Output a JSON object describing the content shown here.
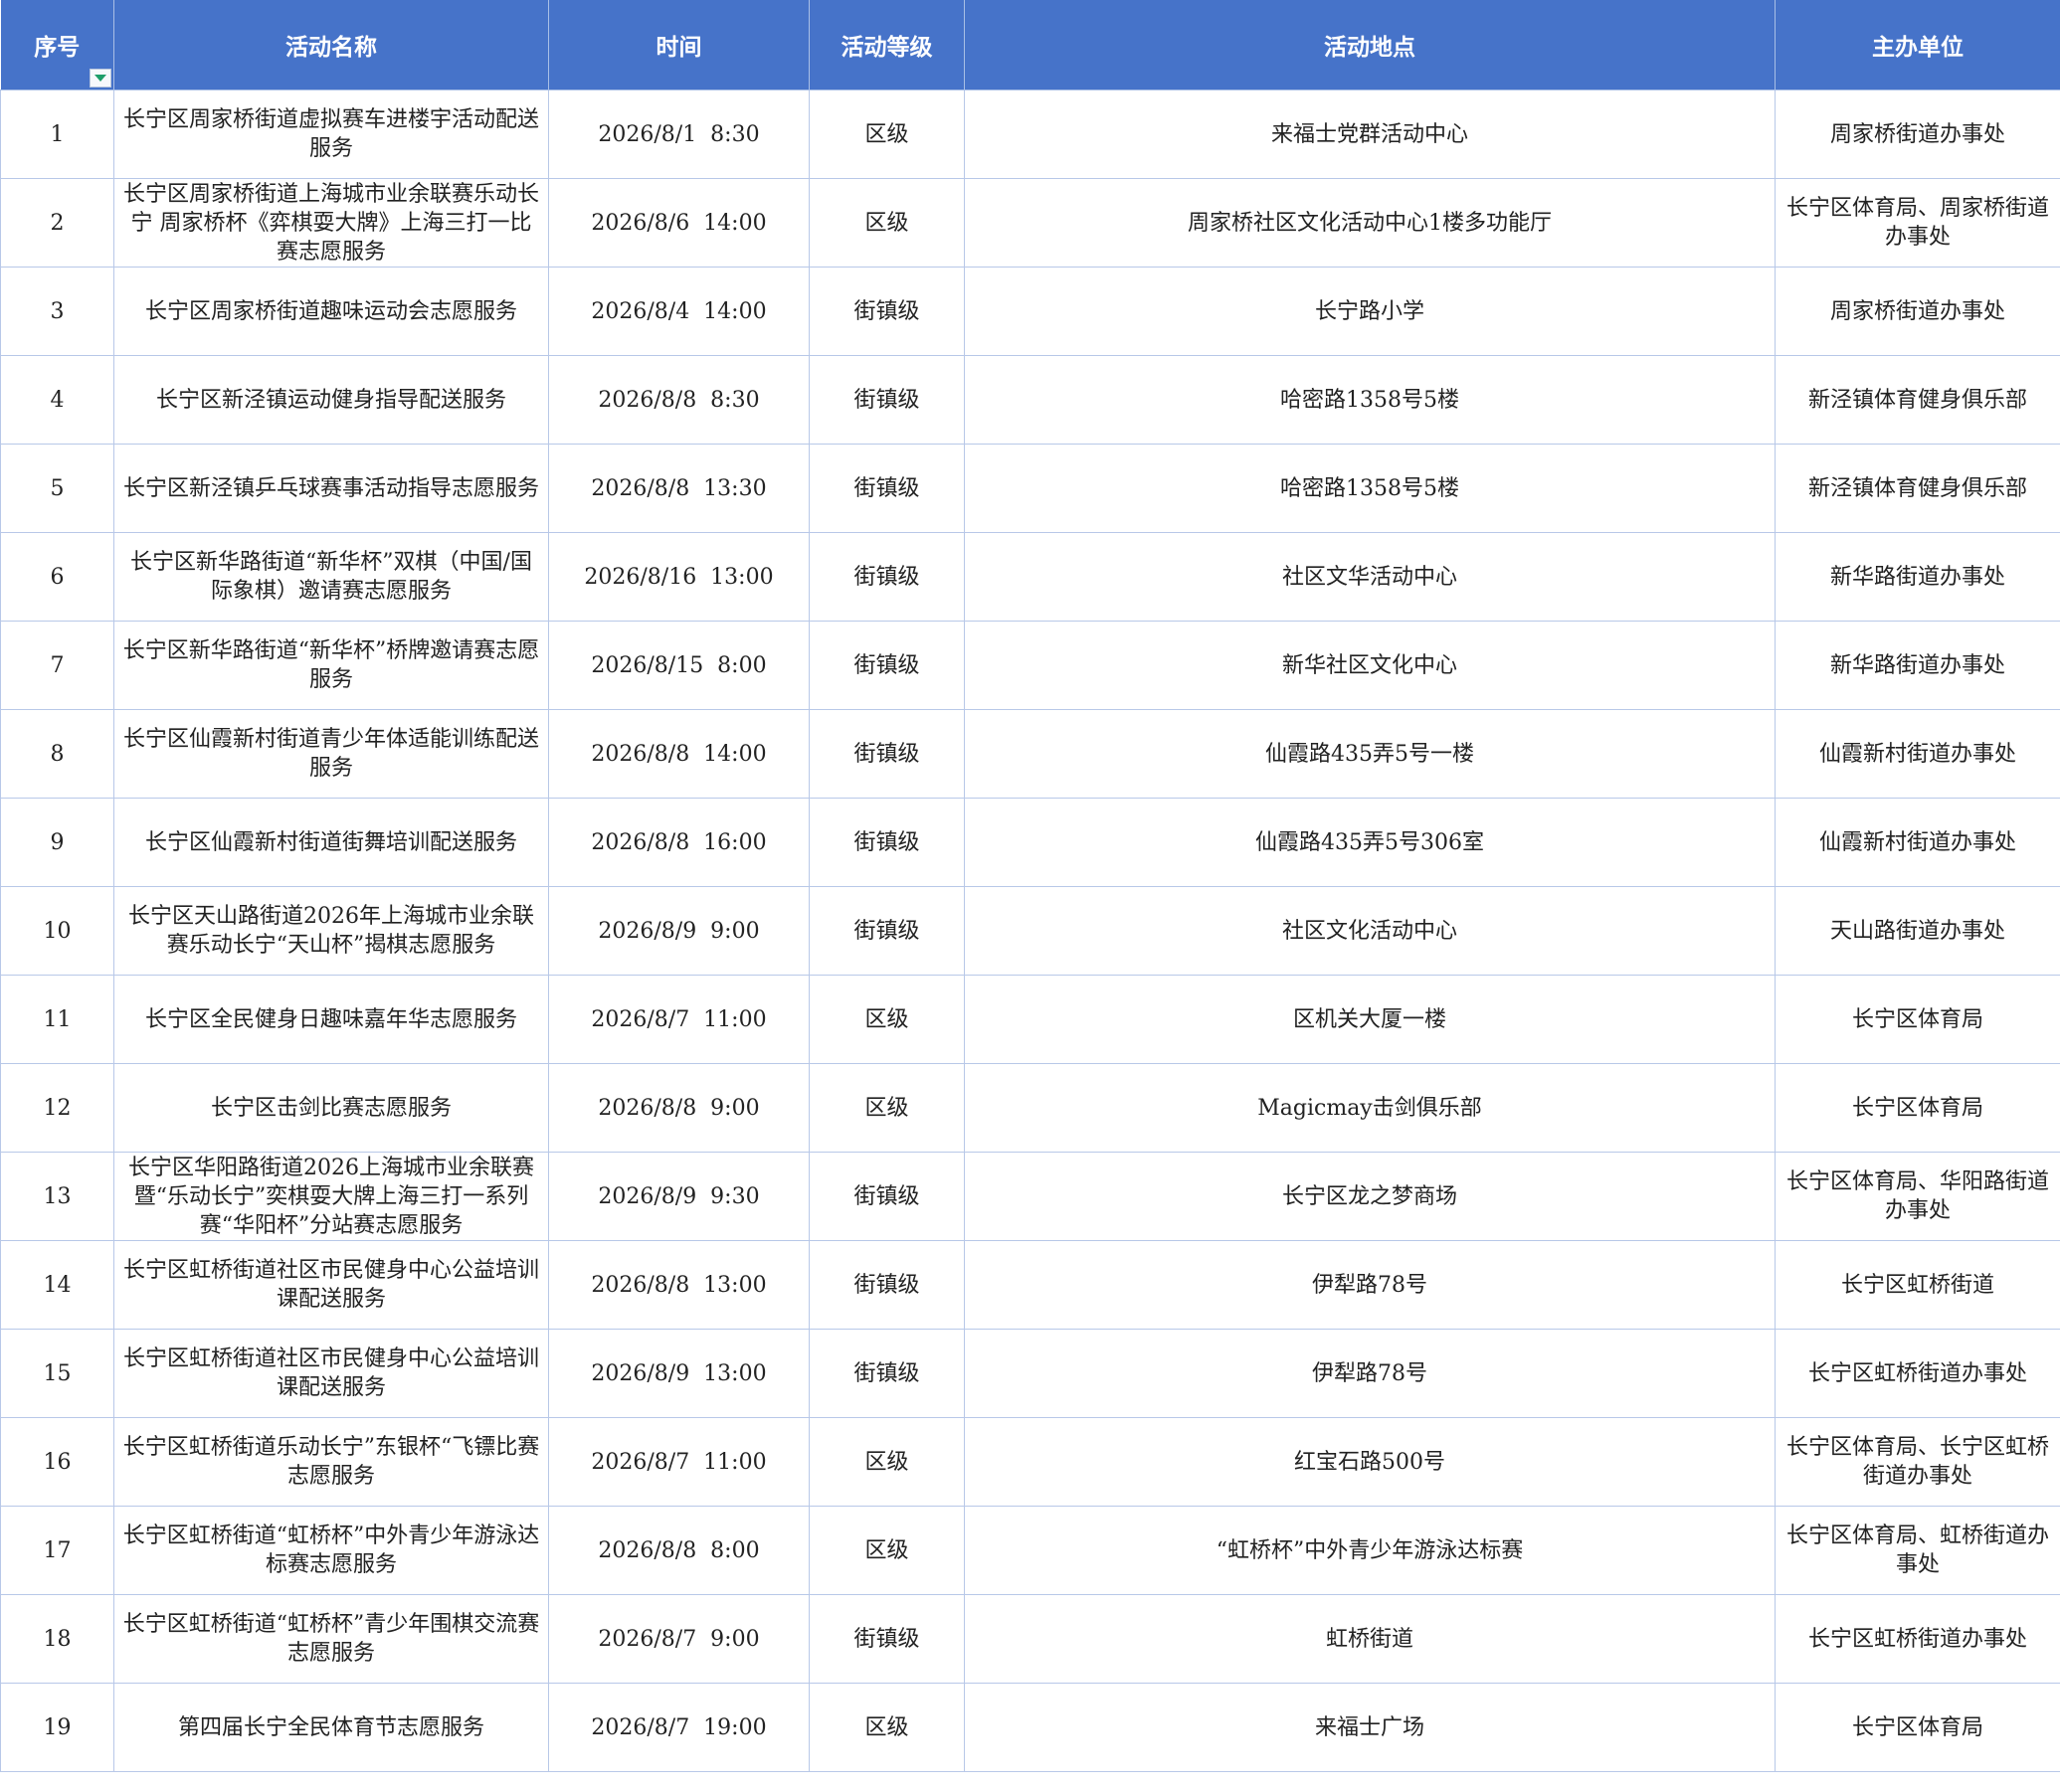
{
  "headers": [
    "序号",
    "活动名称",
    "时间",
    "活动等级",
    "活动地点",
    "主办单位"
  ],
  "rows": [
    [
      "1",
      "长宁区周家桥街道虚拟赛车进楼宇活动配送服务",
      "2026/8/1  8:30",
      "区级",
      "来福士党群活动中心",
      "周家桥街道办事处"
    ],
    [
      "2",
      "长宁区周家桥街道上海城市业余联赛乐动长宁 周家桥杯《弈棋耍大牌》上海三打一比赛志愿服务",
      "2026/8/6  14:00",
      "区级",
      "周家桥社区文化活动中心1楼多功能厅",
      "长宁区体育局、周家桥街道办事处"
    ],
    [
      "3",
      "长宁区周家桥街道趣味运动会志愿服务",
      "2026/8/4  14:00",
      "街镇级",
      "长宁路小学",
      "周家桥街道办事处"
    ],
    [
      "4",
      "长宁区新泾镇运动健身指导配送服务",
      "2026/8/8  8:30",
      "街镇级",
      "哈密路1358号5楼",
      "新泾镇体育健身俱乐部"
    ],
    [
      "5",
      "长宁区新泾镇乒乓球赛事活动指导志愿服务",
      "2026/8/8  13:30",
      "街镇级",
      "哈密路1358号5楼",
      "新泾镇体育健身俱乐部"
    ],
    [
      "6",
      "长宁区新华路街道“新华杯”双棋（中国/国际象棋）邀请赛志愿服务",
      "2026/8/16  13:00",
      "街镇级",
      "社区文华活动中心",
      "新华路街道办事处"
    ],
    [
      "7",
      "长宁区新华路街道“新华杯”桥牌邀请赛志愿服务",
      "2026/8/15  8:00",
      "街镇级",
      "新华社区文化中心",
      "新华路街道办事处"
    ],
    [
      "8",
      "长宁区仙霞新村街道青少年体适能训练配送服务",
      "2026/8/8  14:00",
      "街镇级",
      "仙霞路435弄5号一楼",
      "仙霞新村街道办事处"
    ],
    [
      "9",
      "长宁区仙霞新村街道街舞培训配送服务",
      "2026/8/8  16:00",
      "街镇级",
      "仙霞路435弄5号306室",
      "仙霞新村街道办事处"
    ],
    [
      "10",
      "长宁区天山路街道2026年上海城市业余联赛乐动长宁“天山杯”揭棋志愿服务",
      "2026/8/9  9:00",
      "街镇级",
      "社区文化活动中心",
      "天山路街道办事处"
    ],
    [
      "11",
      "长宁区全民健身日趣味嘉年华志愿服务",
      "2026/8/7  11:00",
      "区级",
      "区机关大厦一楼",
      "长宁区体育局"
    ],
    [
      "12",
      "长宁区击剑比赛志愿服务",
      "2026/8/8  9:00",
      "区级",
      "Magicmay击剑俱乐部",
      "长宁区体育局"
    ],
    [
      "13",
      "长宁区华阳路街道2026上海城市业余联赛暨“乐动长宁”奕棋耍大牌上海三打一系列赛“华阳杯”分站赛志愿服务",
      "2026/8/9  9:30",
      "街镇级",
      "长宁区龙之梦商场",
      "长宁区体育局、华阳路街道办事处"
    ],
    [
      "14",
      "长宁区虹桥街道社区市民健身中心公益培训课配送服务",
      "2026/8/8  13:00",
      "街镇级",
      "伊犁路78号",
      "长宁区虹桥街道"
    ],
    [
      "15",
      "长宁区虹桥街道社区市民健身中心公益培训课配送服务",
      "2026/8/9  13:00",
      "街镇级",
      "伊犁路78号",
      "长宁区虹桥街道办事处"
    ],
    [
      "16",
      "长宁区虹桥街道乐动长宁”东银杯“飞镖比赛志愿服务",
      "2026/8/7  11:00",
      "区级",
      "红宝石路500号",
      "长宁区体育局、长宁区虹桥街道办事处"
    ],
    [
      "17",
      "长宁区虹桥街道“虹桥杯”中外青少年游泳达标赛志愿服务",
      "2026/8/8  8:00",
      "区级",
      "“虹桥杯”中外青少年游泳达标赛",
      "长宁区体育局、虹桥街道办事处"
    ],
    [
      "18",
      "长宁区虹桥街道“虹桥杯”青少年围棋交流赛志愿服务",
      "2026/8/7  9:00",
      "街镇级",
      "虹桥街道",
      "长宁区虹桥街道办事处"
    ],
    [
      "19",
      "第四届长宁全民体育节志愿服务",
      "2026/8/7  19:00",
      "区级",
      "来福士广场",
      "长宁区体育局"
    ]
  ],
  "colors": {
    "header_bg": "#4673c9",
    "header_text": "#ffffff",
    "grid_line": "#b8c8e8",
    "filter_arrow": "#1e9e6a"
  },
  "icons": {
    "filter": "filter-dropdown-icon"
  }
}
